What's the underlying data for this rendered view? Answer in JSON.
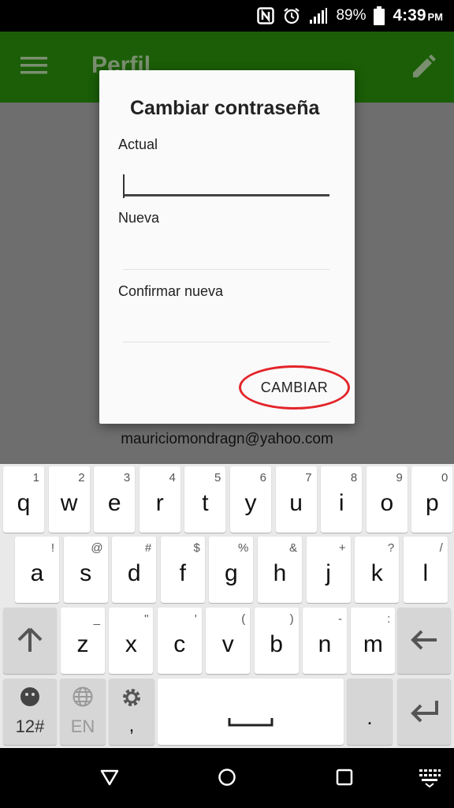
{
  "status_bar": {
    "battery_percent": "89%",
    "time": "4:39",
    "ampm": "PM",
    "icons": [
      "nfc-icon",
      "alarm-icon",
      "signal-icon",
      "battery-icon"
    ]
  },
  "app_bar": {
    "title": "Perfil",
    "menu_icon": "hamburger-menu-icon",
    "edit_icon": "pencil-icon",
    "color": "#1b5e07"
  },
  "profile": {
    "email": "mauriciomondragn@yahoo.com"
  },
  "dialog": {
    "title": "Cambiar contraseña",
    "fields": [
      {
        "label": "Actual",
        "value": ""
      },
      {
        "label": "Nueva",
        "value": ""
      },
      {
        "label": "Confirmar nueva",
        "value": ""
      }
    ],
    "action_label": "CAMBIAR",
    "highlight_color": "#e3252a"
  },
  "keyboard": {
    "row1": [
      {
        "key": "q",
        "sub": "1"
      },
      {
        "key": "w",
        "sub": "2"
      },
      {
        "key": "e",
        "sub": "3"
      },
      {
        "key": "r",
        "sub": "4"
      },
      {
        "key": "t",
        "sub": "5"
      },
      {
        "key": "y",
        "sub": "6"
      },
      {
        "key": "u",
        "sub": "7"
      },
      {
        "key": "i",
        "sub": "8"
      },
      {
        "key": "o",
        "sub": "9"
      },
      {
        "key": "p",
        "sub": "0"
      }
    ],
    "row2": [
      {
        "key": "a",
        "sub": "!"
      },
      {
        "key": "s",
        "sub": "@"
      },
      {
        "key": "d",
        "sub": "#"
      },
      {
        "key": "f",
        "sub": "$"
      },
      {
        "key": "g",
        "sub": "%"
      },
      {
        "key": "h",
        "sub": "&"
      },
      {
        "key": "j",
        "sub": "+"
      },
      {
        "key": "k",
        "sub": "?"
      },
      {
        "key": "l",
        "sub": "/"
      }
    ],
    "row3": [
      {
        "key": "z",
        "sub": "_"
      },
      {
        "key": "x",
        "sub": "\""
      },
      {
        "key": "c",
        "sub": "'"
      },
      {
        "key": "v",
        "sub": "("
      },
      {
        "key": "b",
        "sub": ")"
      },
      {
        "key": "n",
        "sub": "-"
      },
      {
        "key": "m",
        "sub": ":"
      }
    ],
    "symbols_label": "12#",
    "language_label": "EN",
    "comma_label": ",",
    "period_label": ".",
    "icons": [
      "shift-icon",
      "backspace-icon",
      "emoji-icon",
      "globe-icon",
      "settings-icon",
      "space-icon",
      "enter-icon"
    ]
  },
  "nav_bar": {
    "icons": [
      "back-icon",
      "home-icon",
      "recents-icon",
      "keyboard-icon"
    ]
  }
}
